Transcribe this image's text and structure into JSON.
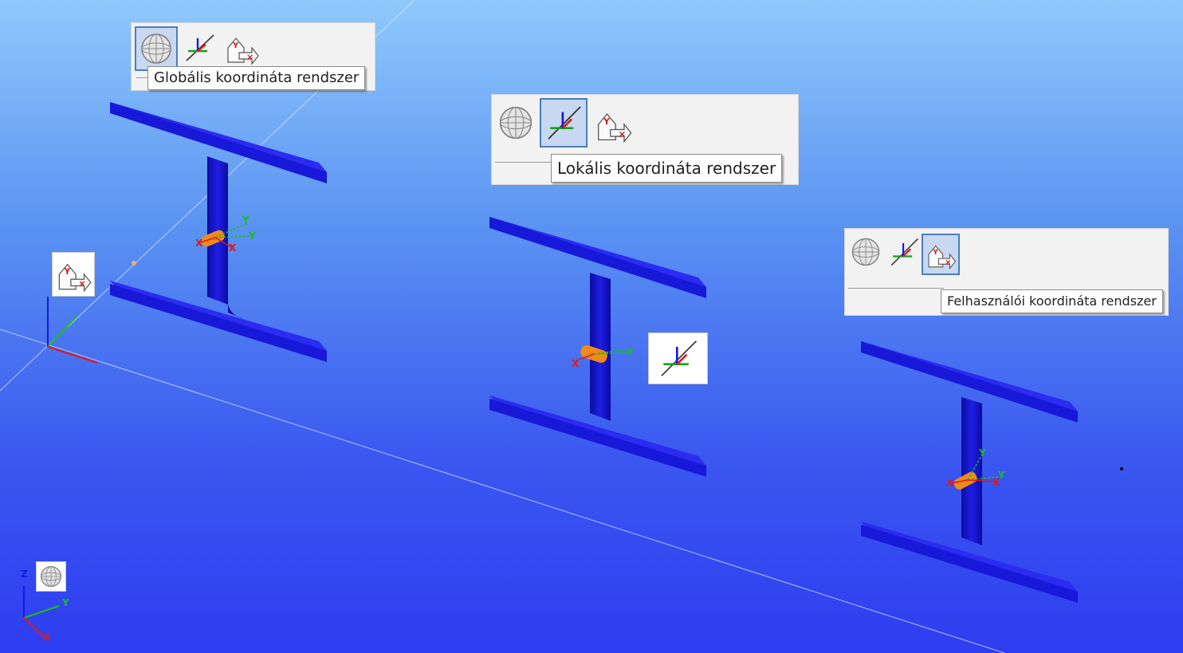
{
  "toolbars": [
    {
      "active": "global",
      "tooltip": "Globális koordináta rendszer",
      "buttons": [
        {
          "id": "global",
          "icon": "globe-icon"
        },
        {
          "id": "local",
          "icon": "local-axes-icon"
        },
        {
          "id": "user",
          "icon": "user-coordinate-icon"
        }
      ]
    },
    {
      "active": "local",
      "tooltip": "Lokális koordináta rendszer",
      "buttons": [
        {
          "id": "global",
          "icon": "globe-icon"
        },
        {
          "id": "local",
          "icon": "local-axes-icon"
        },
        {
          "id": "user",
          "icon": "user-coordinate-icon"
        }
      ]
    },
    {
      "active": "user",
      "tooltip": "Felhasználói koordináta rendszer",
      "buttons": [
        {
          "id": "global",
          "icon": "globe-icon"
        },
        {
          "id": "local",
          "icon": "local-axes-icon"
        },
        {
          "id": "user",
          "icon": "user-coordinate-icon"
        }
      ]
    }
  ],
  "axis_labels": {
    "x": "X",
    "y": "Y",
    "z": "Z"
  },
  "icon_labels": {
    "y": "Y",
    "x": "×"
  },
  "colors": {
    "beam": "#1a1adc",
    "beam_dark": "#0c0c9a",
    "beam_top": "#3030f0",
    "axis_x": "#e01818",
    "axis_y": "#18c018",
    "axis_z": "#1818e0",
    "pivot": "#f08a1a",
    "active_button": "#c7d8f0",
    "toolbar_bg": "#f2f2f2"
  }
}
